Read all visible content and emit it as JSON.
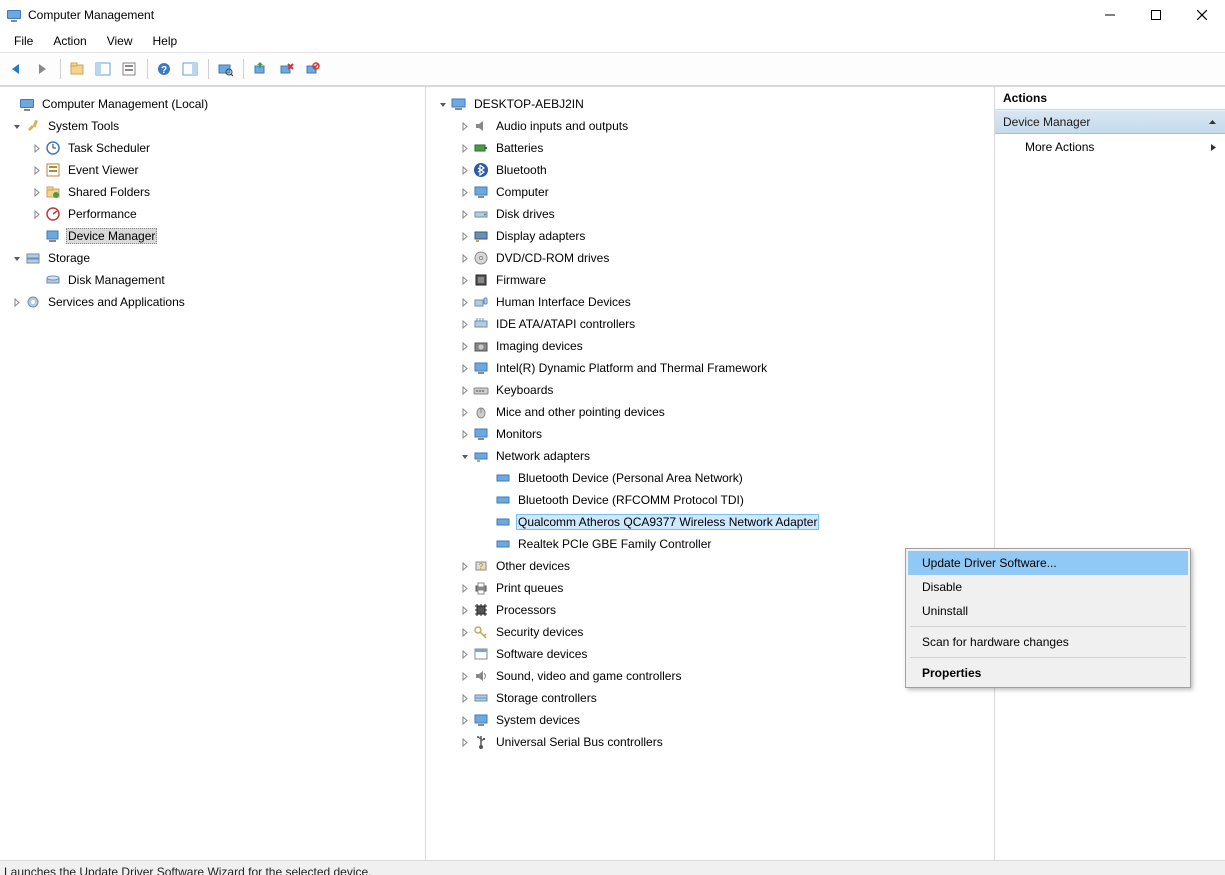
{
  "window": {
    "title": "Computer Management",
    "status": "Launches the Update Driver Software Wizard for the selected device."
  },
  "menu": {
    "file": "File",
    "action": "Action",
    "view": "View",
    "help": "Help"
  },
  "left_tree": {
    "root": "Computer Management (Local)",
    "system_tools": "System Tools",
    "task_scheduler": "Task Scheduler",
    "event_viewer": "Event Viewer",
    "shared_folders": "Shared Folders",
    "performance": "Performance",
    "device_manager": "Device Manager",
    "storage": "Storage",
    "disk_management": "Disk Management",
    "services_apps": "Services and Applications"
  },
  "center_tree": {
    "root": "DESKTOP-AEBJ2IN",
    "cats": {
      "audio": "Audio inputs and outputs",
      "batteries": "Batteries",
      "bluetooth": "Bluetooth",
      "computer": "Computer",
      "disk_drives": "Disk drives",
      "display_adapters": "Display adapters",
      "dvd": "DVD/CD-ROM drives",
      "firmware": "Firmware",
      "hid": "Human Interface Devices",
      "ide": "IDE ATA/ATAPI controllers",
      "imaging": "Imaging devices",
      "intel_dptf": "Intel(R) Dynamic Platform and Thermal Framework",
      "keyboards": "Keyboards",
      "mice": "Mice and other pointing devices",
      "monitors": "Monitors",
      "network": "Network adapters",
      "other": "Other devices",
      "print_queues": "Print queues",
      "processors": "Processors",
      "security": "Security devices",
      "software": "Software devices",
      "sound": "Sound, video and game controllers",
      "storage_ctrl": "Storage controllers",
      "system_devices": "System devices",
      "usb": "Universal Serial Bus controllers"
    },
    "net_children": {
      "bt_pan": "Bluetooth Device (Personal Area Network)",
      "bt_rfcomm": "Bluetooth Device (RFCOMM Protocol TDI)",
      "qca9377": "Qualcomm Atheros QCA9377 Wireless Network Adapter",
      "realtek": "Realtek PCIe GBE Family Controller"
    }
  },
  "right_pane": {
    "header": "Actions",
    "section": "Device Manager",
    "more_actions": "More Actions"
  },
  "context_menu": {
    "update": "Update Driver Software...",
    "disable": "Disable",
    "uninstall": "Uninstall",
    "scan": "Scan for hardware changes",
    "properties": "Properties"
  }
}
